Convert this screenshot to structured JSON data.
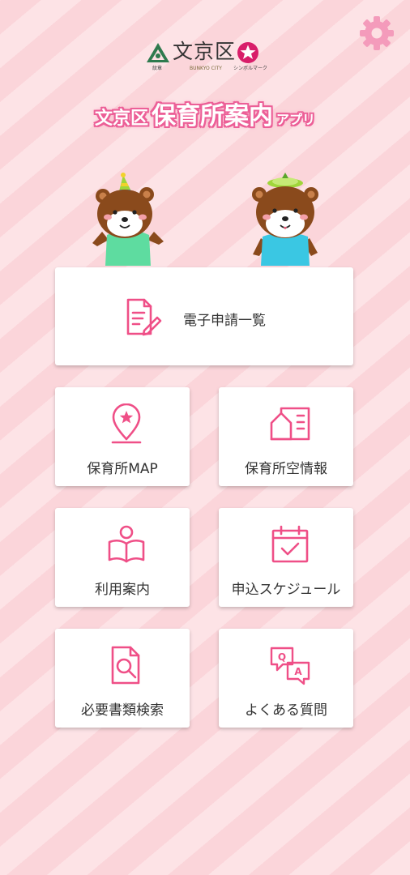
{
  "header": {
    "settings_icon": "gear-icon",
    "logo": {
      "name": "文京区",
      "emblem_caption": "紋章",
      "city_caption": "BUNKYO CITY",
      "symbol_caption": "シンボルマーク"
    },
    "app_title": {
      "prefix": "文京区",
      "main": "保育所案内",
      "suffix": "アプリ"
    }
  },
  "colors": {
    "accent": "#f0508a",
    "title_outline": "#ec5f97",
    "icon_pink": "#ef4f87",
    "background_stripe_light": "#fde3e6",
    "background_stripe_dark": "#fbd5da",
    "settings_gear": "#f49bbb"
  },
  "menu": {
    "primary": {
      "label": "電子申請一覧",
      "icon": "document-edit-icon"
    },
    "items": [
      {
        "label": "保育所MAP",
        "icon": "map-pin-star-icon"
      },
      {
        "label": "保育所空情報",
        "icon": "building-list-icon"
      },
      {
        "label": "利用案内",
        "icon": "person-reading-icon"
      },
      {
        "label": "申込スケジュール",
        "icon": "calendar-check-icon"
      },
      {
        "label": "必要書類検索",
        "icon": "document-search-icon"
      },
      {
        "label": "よくある質問",
        "icon": "qa-bubbles-icon"
      }
    ]
  }
}
